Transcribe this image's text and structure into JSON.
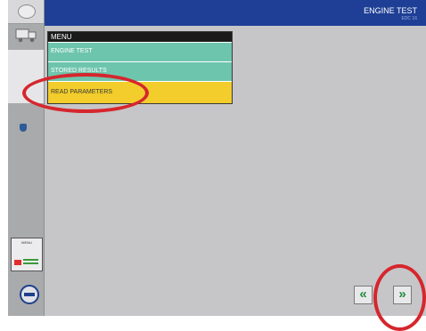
{
  "header": {
    "title": "ENGINE TEST",
    "subtitle": "EDC 16"
  },
  "sidebar": {
    "mini_panel_label": "MENU"
  },
  "menu": {
    "title": "MENU",
    "items": [
      {
        "label": "ENGINE TEST"
      },
      {
        "label": "STORED RESULTS"
      },
      {
        "label": "READ PARAMETERS"
      }
    ]
  },
  "nav": {
    "back_label": "«",
    "forward_label": "»"
  },
  "colors": {
    "header_bg": "#1e3f95",
    "teal_item": "#6ec5ad",
    "selected_item": "#f2cd2b",
    "annotation": "#d6262d"
  }
}
